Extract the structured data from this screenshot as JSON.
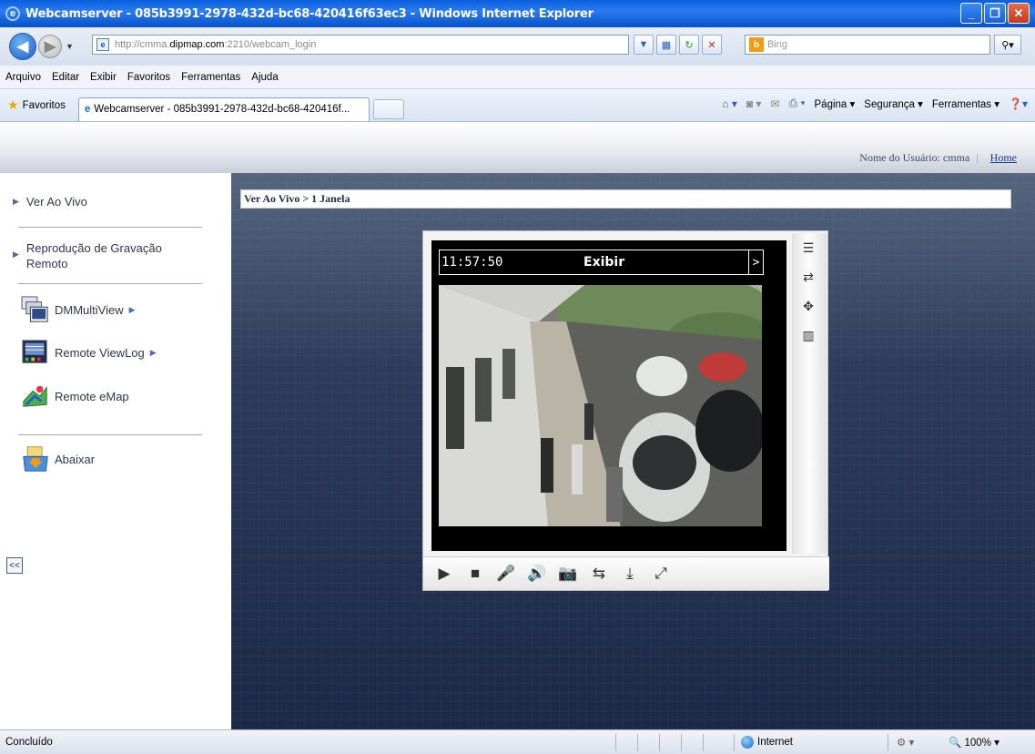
{
  "window": {
    "title": "Webcamserver - 085b3991-2978-432d-bc68-420416f63ec3 - Windows Internet Explorer"
  },
  "address": {
    "url_prefix": "http://cmma.",
    "url_domain": "dipmap.com",
    "url_suffix": ":2210/webcam_login",
    "search_placeholder": "Bing"
  },
  "menu": [
    "Arquivo",
    "Editar",
    "Exibir",
    "Favoritos",
    "Ferramentas",
    "Ajuda"
  ],
  "favorites": {
    "label": "Favoritos",
    "tab_title": "Webcamserver - 085b3991-2978-432d-bc68-420416f..."
  },
  "commands": {
    "page": "Página",
    "security": "Segurança",
    "tools": "Ferramentas"
  },
  "header": {
    "user_label": "Nome do Usuário: cmma",
    "separator": "|",
    "home": "Home"
  },
  "sidebar": {
    "live": "Ver Ao Vivo",
    "playback_line1": "Reprodução de Gravação",
    "playback_line2": "Remoto",
    "multiview": "DMMultiView",
    "viewlog": "Remote ViewLog",
    "emap": "Remote eMap",
    "download": "Abaixar",
    "collapse": "<<"
  },
  "main": {
    "breadcrumb": "Ver Ao Vivo > 1 Janela"
  },
  "video": {
    "time": "11:57:50",
    "label": "Exibir",
    "next": ">"
  },
  "status": {
    "text": "Concluído",
    "zone": "Internet",
    "zoom": "100%"
  },
  "colors": {
    "titlebar": "#0a5fdc",
    "main_bg": "#2d3c5b",
    "sidebar_text": "#2b3752"
  }
}
